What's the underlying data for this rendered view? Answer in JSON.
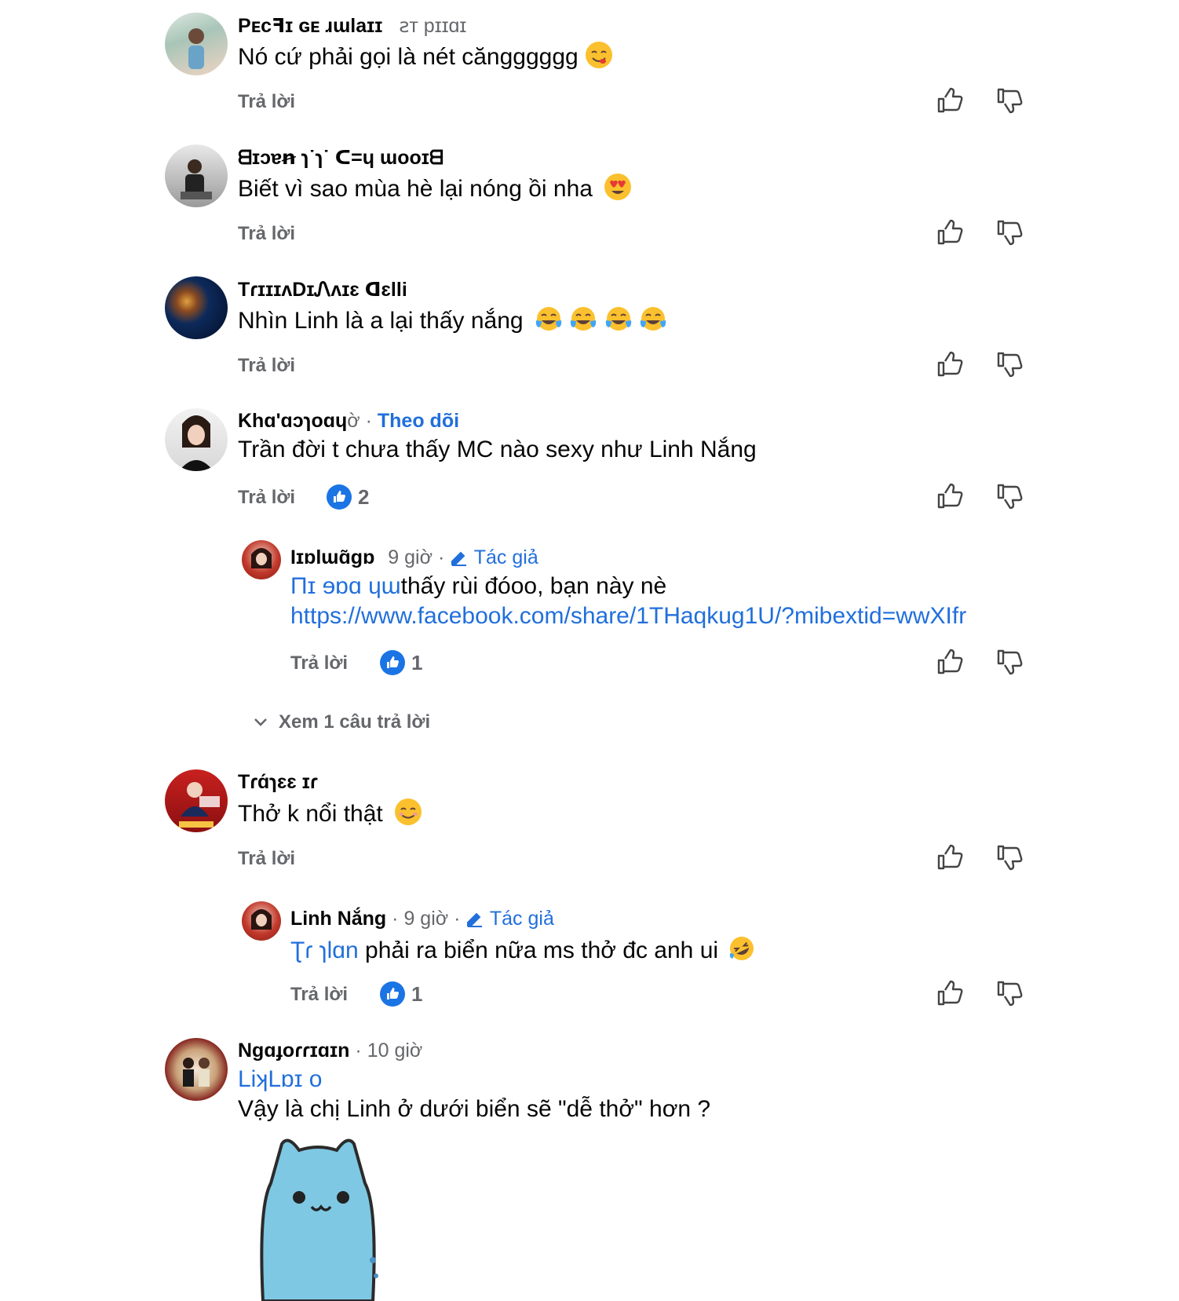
{
  "comments": [
    {
      "name": "Pᴇcꟻɪ ɢᴇ ɹɯlaɪɪ",
      "meta": "ꙅᴛ pɪɪɑɪ",
      "text": "Nó cứ phải gọi là nét căngggggg",
      "reply": "Trả lời"
    },
    {
      "name": "ᗺɪɔɐꞥ ɿ˙ɿ˙ ᑕ=ɥ ɯooɪᗺ",
      "text": "Biết vì sao mùa hè lại nóng ồi nha",
      "reply": "Trả lời"
    },
    {
      "name": "TɾɪɪɪᴧDɪᏁᴧɪɛ ᗡɛlli",
      "text": "Nhìn Linh là a lại thấy nắng",
      "reply": "Trả lời"
    },
    {
      "name": "Khɑ'ɑɔɿoɑɥ",
      "meta": "ờ ·",
      "follow": "Theo dõi",
      "text": "Trần đời t chưa thấy MC nào sexy như Linh Nắng",
      "reply": "Trả lời",
      "likes": "2"
    },
    {
      "name": "Iɪɒlɯɑ̃ɡɒ",
      "meta": "9 giờ ·",
      "author": "Tác giả",
      "text_prefix": "Пɪ ɘɒɑ ɥɯ",
      "text": "thấy rùi đóoo, bạn này nè",
      "link": "https://www.facebook.com/share/1THaqkug1U/?mibextid=wwXIfr",
      "reply": "Trả lời",
      "likes": "1"
    },
    {
      "more": "Xem 1 câu trả lời"
    },
    {
      "name": "Tɾɑ́ɿɛɛ  ɪɾ",
      "text": "Thở k nổi thật",
      "reply": "Trả lời"
    },
    {
      "name": "Linh Nắng",
      "meta": "· 9 giờ ·",
      "author": "Tác giả",
      "mention": "Ʈɾ ɿlɑn",
      "text": "phải ra biển nữa ms thở đc anh ui",
      "reply": "Trả lời",
      "likes": "1"
    },
    {
      "name": "Ngɑɟoɾɾɪɑɪn",
      "meta": "· 10 giờ",
      "mention": "LiʞLɒɪ o",
      "text": "Vậy là chị Linh ở dưới biển sẽ \"dễ thở\" hơn ?"
    }
  ],
  "colors": {
    "link": "#216fdb",
    "meta": "#65676b",
    "like": "#1b74e4"
  },
  "icons": [
    "thumbs-up-icon",
    "thumbs-down-icon",
    "like-reaction-icon",
    "chevron-down-icon",
    "edit-pencil-icon"
  ]
}
